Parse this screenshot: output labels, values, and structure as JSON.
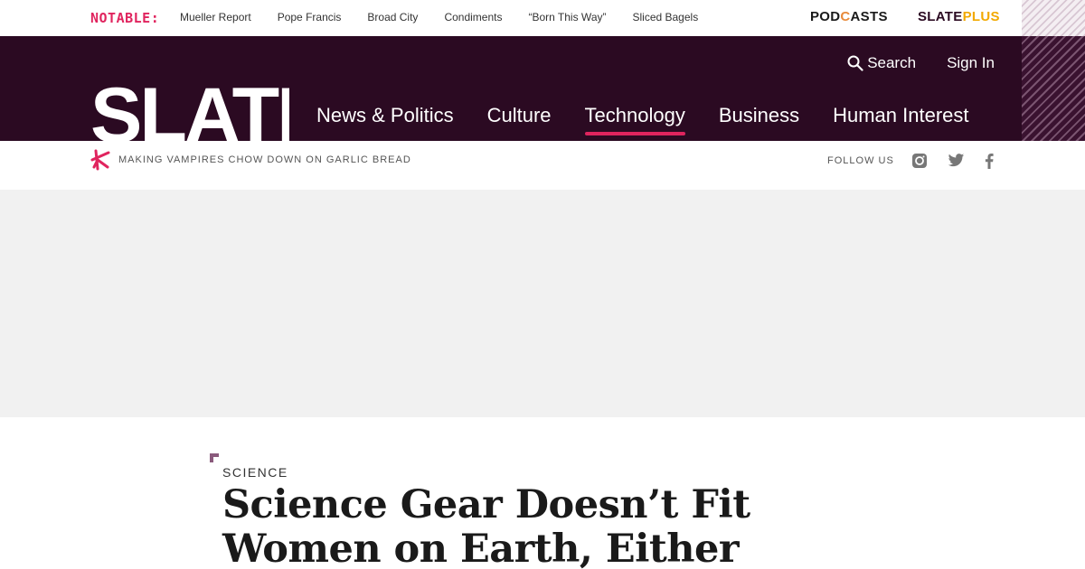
{
  "topbar": {
    "notable_label": "NOTABLE:",
    "topics": [
      "Mueller Report",
      "Pope Francis",
      "Broad City",
      "Condiments",
      "“Born This Way”",
      "Sliced Bagels"
    ],
    "podcasts_pre": "POD",
    "podcasts_o": "C",
    "podcasts_post": "ASTS",
    "slateplus_a": "SLATE",
    "slateplus_b": "PLUS"
  },
  "header": {
    "logo": "SLATE",
    "search_label": "Search",
    "signin_label": "Sign In",
    "nav": [
      "News & Politics",
      "Culture",
      "Technology",
      "Business",
      "Human Interest"
    ],
    "active_nav": "Technology"
  },
  "subbar": {
    "tagline": "Making vampires chow down on garlic bread",
    "follow_label": "Follow Us"
  },
  "article": {
    "kicker": "Science",
    "headline": "Science Gear Doesn’t Fit Women on Earth, Either"
  },
  "colors": {
    "brand_dark": "#2b0a22",
    "accent": "#e0245e",
    "plus_gold": "#f2a900"
  }
}
